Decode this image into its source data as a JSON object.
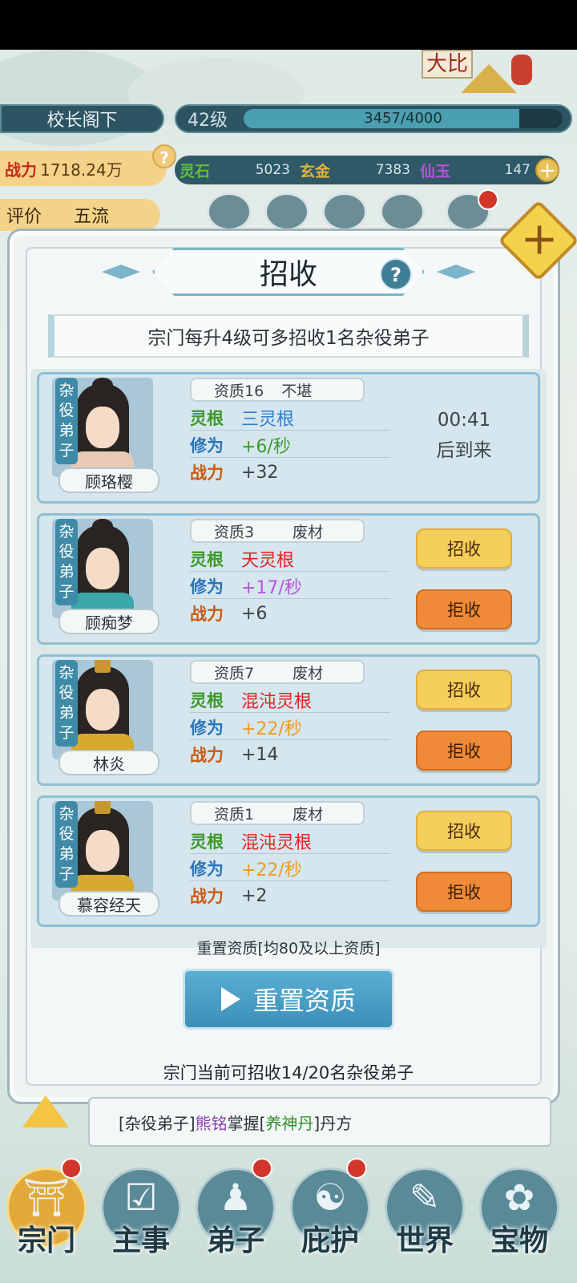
{
  "header": {
    "player_name": "校长阁下",
    "level": "42级",
    "exp_text": "3457/4000",
    "exp_fraction": 0.864,
    "power_label": "战力",
    "power_value": "1718.24万",
    "help_icon": "?",
    "resources": [
      {
        "label": "灵石",
        "value": "5023",
        "color": "#5fbf3a"
      },
      {
        "label": "玄金",
        "value": "7383",
        "color": "#e2b33a"
      },
      {
        "label": "仙玉",
        "value": "147",
        "color": "#b455d6"
      }
    ],
    "plus_icon": "+",
    "rating_label": "评价",
    "rating_value": "五流"
  },
  "scene": {
    "signboard": "大比"
  },
  "modal": {
    "title": "招收",
    "help_icon": "?",
    "close_icon": "close-icon",
    "notice": "宗门每升4级可多招收1名杂役弟子",
    "role_tag": "杂役弟子",
    "labels": {
      "root": "灵根",
      "cultivation": "修为",
      "power": "战力"
    },
    "accept_label": "招收",
    "reject_label": "拒收",
    "candidates": [
      {
        "name": "顾珞樱",
        "aptitude": "资质16",
        "grade": "不堪",
        "root": "三灵根",
        "root_color": "#2f7ccf",
        "cultivation": "+6/秒",
        "cultivation_color": "#3c9a2b",
        "power": "+32",
        "timer": "00:41",
        "timer_suffix": "后到来"
      },
      {
        "name": "顾痴梦",
        "aptitude": "资质3",
        "grade": "废材",
        "root": "天灵根",
        "root_color": "#e02424",
        "cultivation": "+17/秒",
        "cultivation_color": "#b455d6",
        "power": "+6"
      },
      {
        "name": "林炎",
        "aptitude": "资质7",
        "grade": "废材",
        "root": "混沌灵根",
        "root_color": "#e02424",
        "cultivation": "+22/秒",
        "cultivation_color": "#ef9a1c",
        "power": "+14"
      },
      {
        "name": "慕容经天",
        "aptitude": "资质1",
        "grade": "废材",
        "root": "混沌灵根",
        "root_color": "#e02424",
        "cultivation": "+22/秒",
        "cultivation_color": "#ef9a1c",
        "power": "+2"
      }
    ],
    "reset_note": "重置资质[均80及以上资质]",
    "reset_button": "重置资质",
    "quota_text": "宗门当前可招收14/20名杂役弟子"
  },
  "message": {
    "prefix": "[杂役弟子]",
    "person": "熊铭",
    "verb": "掌握[",
    "item": "养神丹",
    "suffix": "]丹方"
  },
  "nav": [
    {
      "label": "宗门",
      "icon": "sect-icon",
      "glyph": "⛩"
    },
    {
      "label": "主事",
      "icon": "checklist-icon",
      "glyph": "☑"
    },
    {
      "label": "弟子",
      "icon": "disciple-icon",
      "glyph": "♟"
    },
    {
      "label": "庇护",
      "icon": "dragon-icon",
      "glyph": "☯"
    },
    {
      "label": "世界",
      "icon": "scroll-icon",
      "glyph": "✎"
    },
    {
      "label": "宝物",
      "icon": "treasure-bag-icon",
      "glyph": "✿"
    }
  ]
}
